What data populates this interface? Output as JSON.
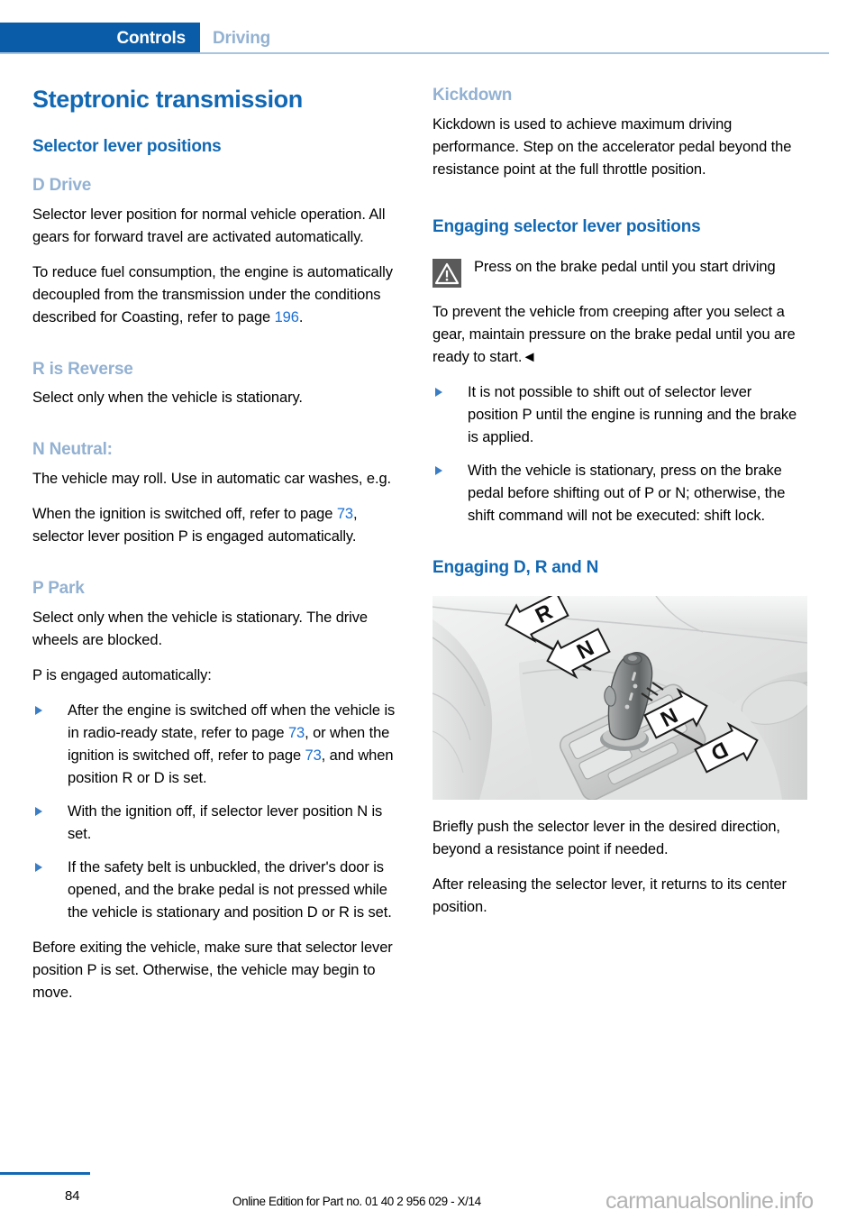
{
  "header": {
    "active_tab": "Controls",
    "inactive_tab": "Driving",
    "accent_color": "#0a5ca8",
    "rule_color": "#a8c4e0"
  },
  "left_column": {
    "title": "Steptronic transmission",
    "section_heading": "Selector lever positions",
    "d_drive": {
      "heading": "D Drive",
      "p1": "Selector lever position for normal vehicle oper­ation. All gears for forward travel are activated automatically.",
      "p2_before": "To reduce fuel consumption, the engine is au­tomatically decoupled from the transmission under the conditions described for Coasting, refer to page ",
      "p2_link": "196",
      "p2_after": "."
    },
    "r_reverse": {
      "heading": "R is Reverse",
      "p1": "Select only when the vehicle is stationary."
    },
    "n_neutral": {
      "heading": "N Neutral:",
      "p1": "The vehicle may roll. Use in automatic car washes, e.g.",
      "p2_before": "When the ignition is switched off, refer to page ",
      "p2_link": "73",
      "p2_after": ", selector lever position P is engaged automatically."
    },
    "p_park": {
      "heading": "P Park",
      "p1": "Select only when the vehicle is stationary. The drive wheels are blocked.",
      "p2": "P is engaged automatically:",
      "bullets": [
        {
          "part1": "After the engine is switched off when the vehicle is in radio-ready state, refer to page ",
          "link1": "73",
          "part2": ", or when the ignition is switched off, refer to page ",
          "link2": "73",
          "part3": ", and when position R or D is set."
        },
        {
          "part1": "With the ignition off, if selector lever posi­tion N is set."
        },
        {
          "part1": "If the safety belt is unbuckled, the driver's door is opened, and the brake pedal is not pressed while the vehicle is stationary and position D or R is set."
        }
      ],
      "p3": "Before exiting the vehicle, make sure that se­lector lever position P is set. Otherwise, the ve­hicle may begin to move."
    }
  },
  "right_column": {
    "kickdown": {
      "heading": "Kickdown",
      "p1": "Kickdown is used to achieve maximum driving performance. Step on the accelerator pedal beyond the resistance point at the full throttle position."
    },
    "engaging_positions": {
      "heading": "Engaging selector lever positions",
      "warning_text": "Press on the brake pedal until you start driving",
      "warning_icon": "warning-triangle-icon",
      "p1": "To prevent the vehicle from creeping after you select a gear, maintain pressure on the brake pedal until you are ready to start.◄",
      "bullets": [
        "It is not possible to shift out of selector lever position P until the engine is running and the brake is applied.",
        "With the vehicle is stationary, press on the brake pedal before shifting out of P or N; otherwise, the shift command will not be executed: shift lock."
      ]
    },
    "engaging_drn": {
      "heading": "Engaging D, R and N",
      "figure": {
        "alt": "Center console with Steptronic selector lever and shift direction arrows",
        "labels": [
          "R",
          "N",
          "N",
          "D"
        ]
      },
      "p1": "Briefly push the selector lever in the desired di­rection, beyond a resistance point if needed.",
      "p2": "After releasing the selector lever, it returns to its center position."
    }
  },
  "footer": {
    "page_number": "84",
    "edition": "Online Edition for Part no. 01 40 2 956 029 - X/14",
    "watermark": "carmanualsonline.info"
  }
}
